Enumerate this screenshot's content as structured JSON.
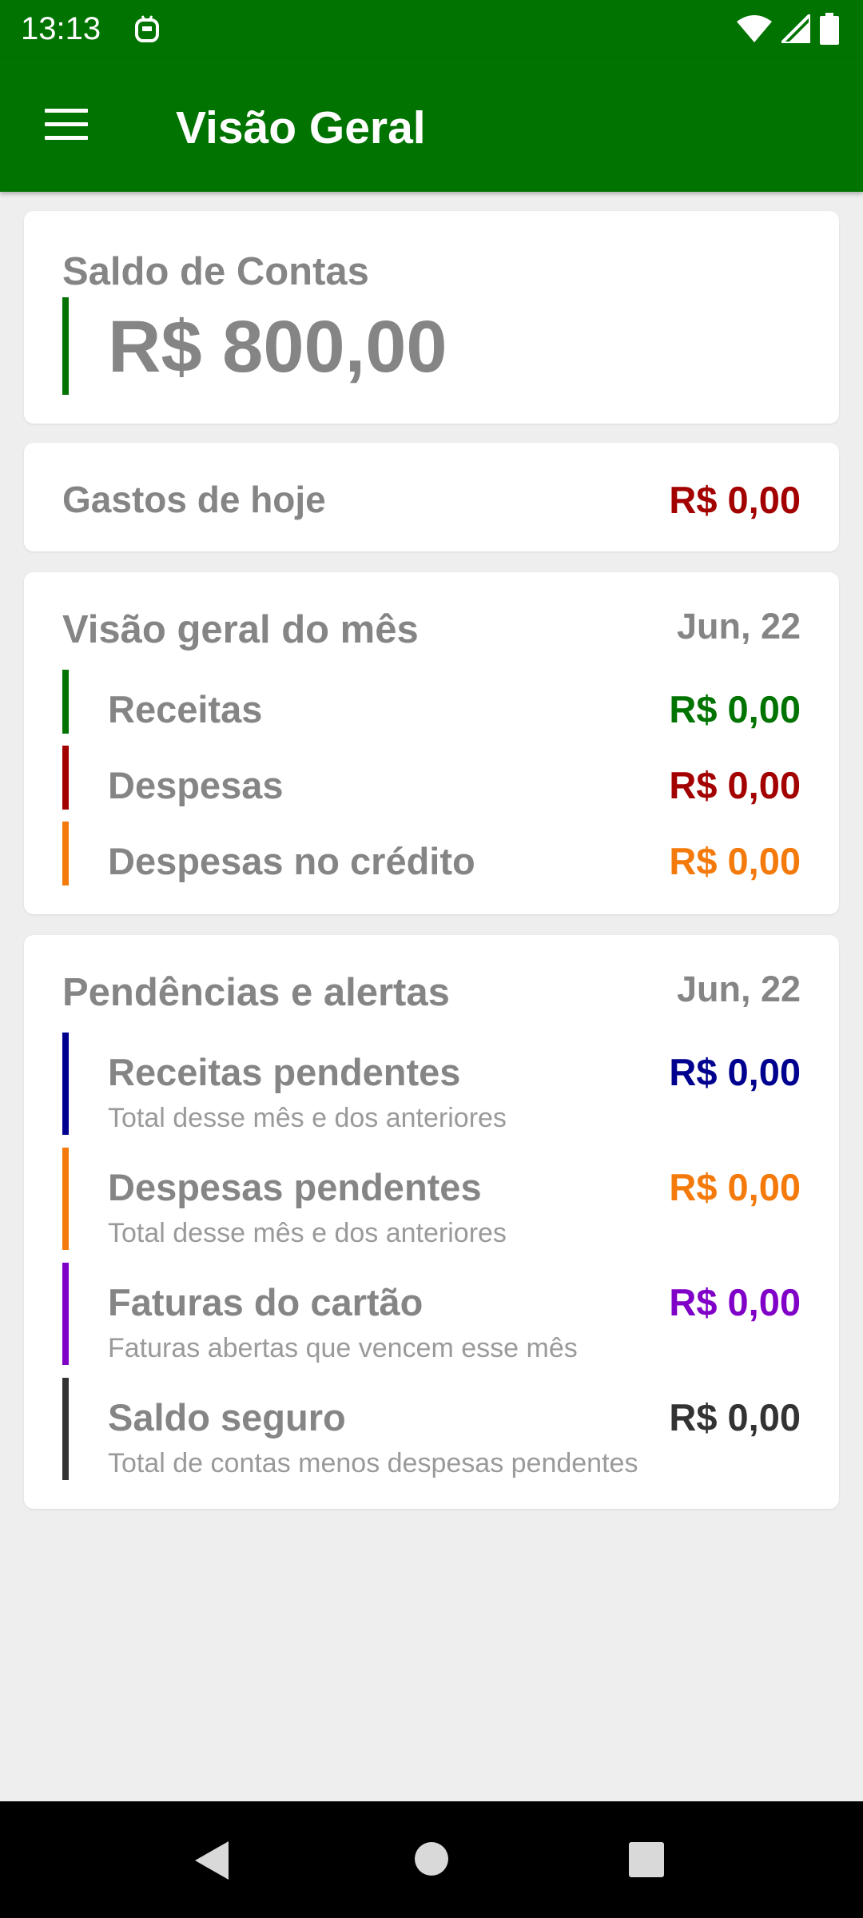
{
  "status_bar": {
    "time": "13:13",
    "icons": [
      "app-notification-icon",
      "wifi-icon",
      "cell-signal-icon",
      "battery-icon"
    ]
  },
  "app_bar": {
    "menu_icon": "hamburger-menu-icon",
    "title": "Visão Geral",
    "color": "#017301"
  },
  "balance_card": {
    "title": "Saldo de Contas",
    "amount": "R$ 800,00",
    "accent": "#017301"
  },
  "today_card": {
    "label": "Gastos de hoje",
    "value": "R$ 0,00",
    "value_color": "#a30000"
  },
  "month_card": {
    "title": "Visão geral do mês",
    "date": "Jun, 22",
    "rows": [
      {
        "label": "Receitas",
        "value": "R$ 0,00",
        "color": "#017301"
      },
      {
        "label": "Despesas",
        "value": "R$ 0,00",
        "color": "#a30000"
      },
      {
        "label": "Despesas no crédito",
        "value": "R$ 0,00",
        "color": "#f47a0b"
      }
    ]
  },
  "alerts_card": {
    "title": "Pendências e alertas",
    "date": "Jun, 22",
    "rows": [
      {
        "label": "Receitas pendentes",
        "sub": "Total desse mês e dos anteriores",
        "value": "R$ 0,00",
        "color": "#00008f"
      },
      {
        "label": "Despesas pendentes",
        "sub": "Total desse mês e dos anteriores",
        "value": "R$ 0,00",
        "color": "#f47a0b"
      },
      {
        "label": "Faturas do cartão",
        "sub": "Faturas abertas que vencem esse mês",
        "value": "R$ 0,00",
        "color": "#8000c8"
      },
      {
        "label": "Saldo seguro",
        "sub": "Total de contas menos despesas pendentes",
        "value": "R$ 0,00",
        "color": "#333333"
      }
    ]
  },
  "nav_bar": {
    "icons": [
      "back-icon",
      "home-icon",
      "recents-icon"
    ]
  }
}
